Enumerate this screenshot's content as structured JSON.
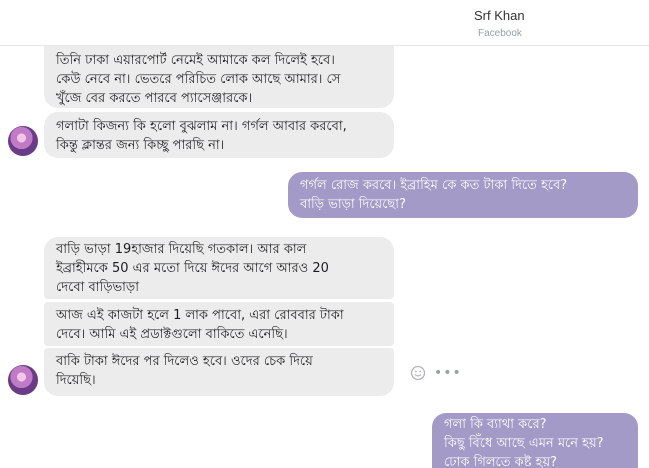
{
  "header": {
    "contact_name": "Srf Khan",
    "contact_subtitle": "Facebook"
  },
  "messages": [
    {
      "direction": "incoming",
      "text": "তিনি ঢাকা এয়ারপোর্ট নেমেই আমাকে কল দিলেই হবে।\nকেউ নেবে না। ভেতরে পরিচিত লোক আছে আমার। সে\nখুঁজে বের করতে পারবে প্যাসেঞ্জারকে।"
    },
    {
      "direction": "incoming",
      "text": "গলাটা কিজন্য কি হলো বুঝলাম না। গর্গল আবার করবো,\nকিন্তু ক্লান্তর জন্য কিচ্ছু পারছি না।"
    },
    {
      "direction": "outgoing",
      "text": "গর্গল রোজ করবে। ইব্রাহিম কে কত টাকা দিতে হবে?\nবাড়ি ভাড়া দিয়েছো?"
    },
    {
      "direction": "incoming",
      "text": "বাড়ি ভাড়া 19হাজার দিয়েছি গতকাল। আর কাল\nইব্রাহীমকে 50 এর মতো দিয়ে ঈদের আগে আরও 20\nদেবো বাড়িভাড়া"
    },
    {
      "direction": "incoming",
      "text": "আজ এই কাজটা হলে 1 লাক পাবো, এরা রোববার টাকা\nদেবে। আমি এই প্রডাক্টগুলো বাকিতে এনেছি।"
    },
    {
      "direction": "incoming",
      "text": "বাকি টাকা ঈদের পর দিলেও হবে। ওদের চেক দিয়ে\nদিয়েছি।"
    },
    {
      "direction": "outgoing",
      "text": "গলা কি ব্যাথা করে?\nকিছু বিঁধে আছে এমন মনে হয়?\nঢোক গিলতে কষ্ট হয়?"
    }
  ],
  "icons": {
    "react": "smile-icon",
    "more": "more-options-icon",
    "avatar": "avatar"
  },
  "colors": {
    "incoming_bubble": "#ececec",
    "outgoing_bubble": "#a49ac8"
  }
}
